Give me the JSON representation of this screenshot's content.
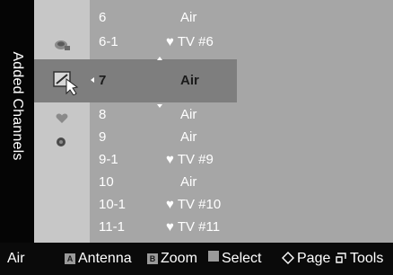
{
  "sidebar": {
    "title": "Added Channels"
  },
  "channels": [
    {
      "number": "6",
      "name": "Air",
      "favorite": false
    },
    {
      "number": "6-1",
      "name": "TV #6",
      "favorite": true
    },
    {
      "number": "7",
      "name": "Air",
      "favorite": false,
      "selected": true
    },
    {
      "number": "8",
      "name": "Air",
      "favorite": false
    },
    {
      "number": "9",
      "name": "Air",
      "favorite": false
    },
    {
      "number": "9-1",
      "name": "TV #9",
      "favorite": true
    },
    {
      "number": "10",
      "name": "Air",
      "favorite": false
    },
    {
      "number": "10-1",
      "name": "TV #10",
      "favorite": true
    },
    {
      "number": "11-1",
      "name": "TV #11",
      "favorite": true
    }
  ],
  "favorite_symbol": "♥",
  "footer": {
    "antenna_value": "Air",
    "key_a": "A",
    "antenna_label": "Antenna",
    "key_b": "B",
    "zoom_label": "Zoom",
    "select_label": "Select",
    "page_label": "Page",
    "tools_label": "Tools"
  },
  "icons": [
    "antenna-icon",
    "edit-cursor-icon",
    "favorite-heart-icon",
    "lock-icon",
    "page-diamond-icon",
    "tools-icon"
  ],
  "colors": {
    "panel_background": "#a6a6a6",
    "sidebar": "#050505",
    "highlight": "#7e7e7e",
    "footer": "#0a0a0a"
  }
}
